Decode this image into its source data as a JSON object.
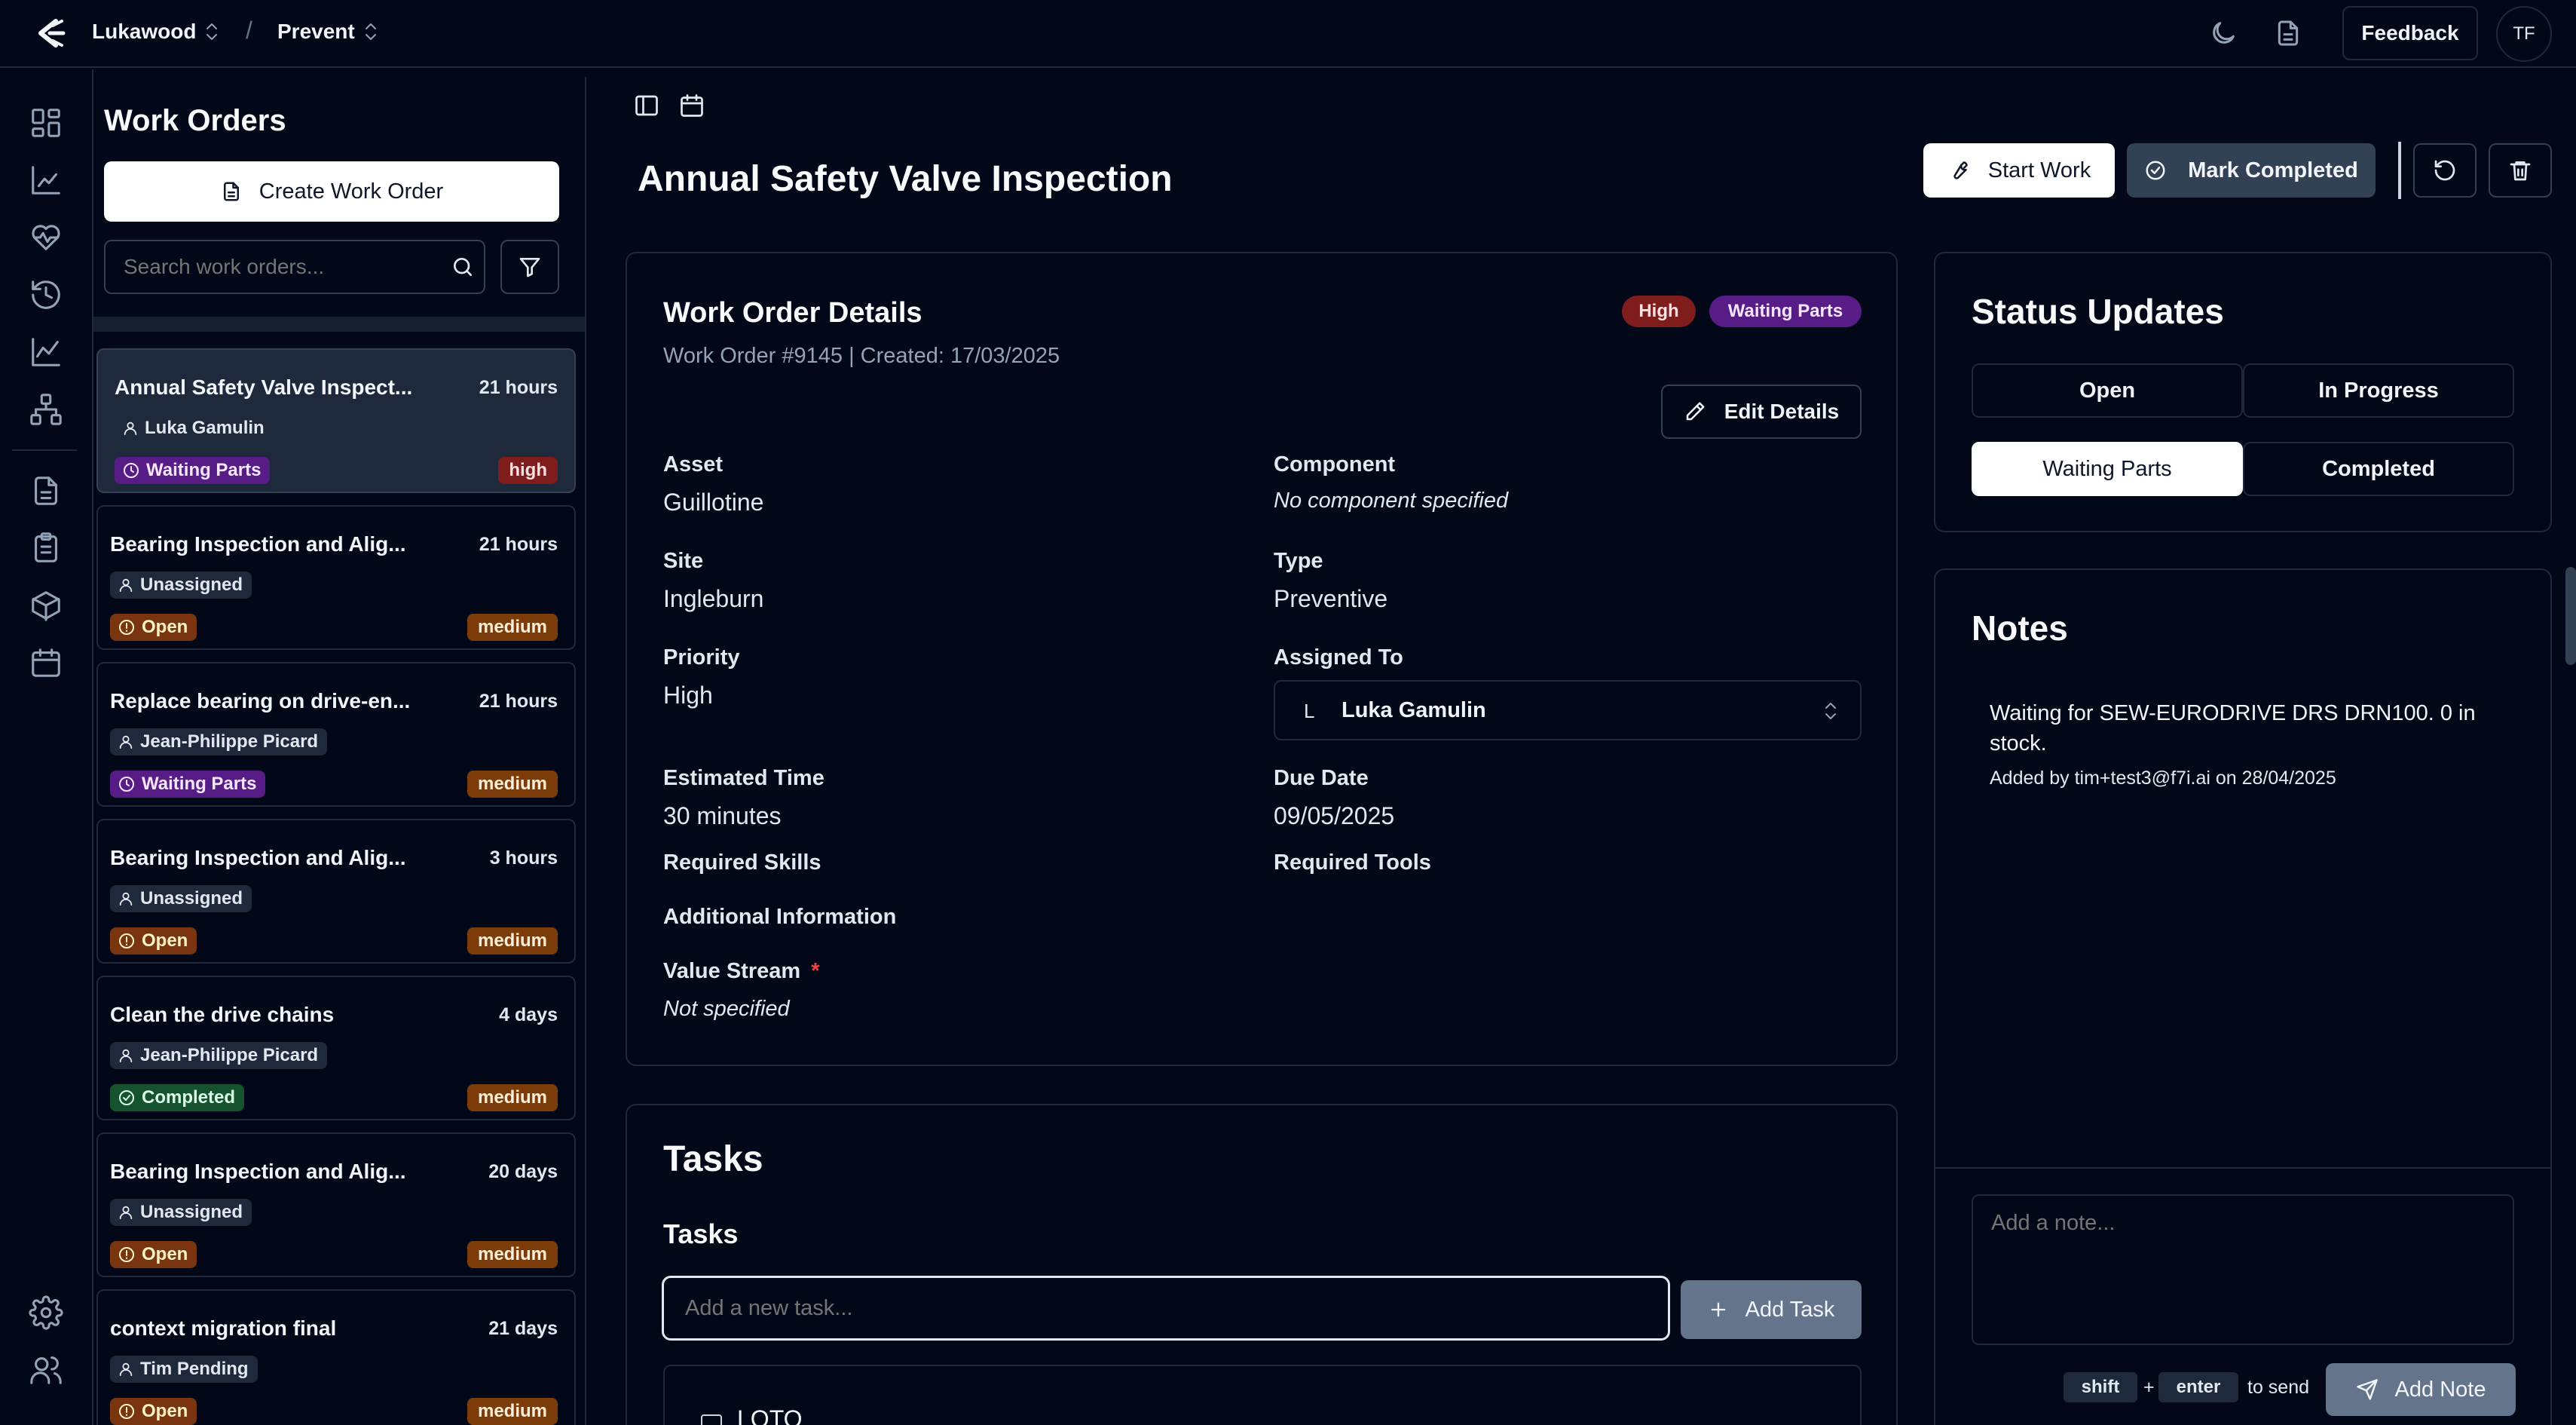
{
  "topbar": {
    "org": "Lukawood",
    "separator": "/",
    "app": "Prevent",
    "feedback": "Feedback",
    "avatar_initials": "TF"
  },
  "icons": {
    "logo": "chevron-burst-logo",
    "theme": "moon-icon",
    "docs": "document-icon",
    "rail": [
      "dashboard-icon",
      "bar-chart-icon",
      "heart-pulse-icon",
      "history-icon",
      "line-chart-icon",
      "hierarchy-icon",
      "work-orders-icon",
      "clipboard-icon",
      "box-icon",
      "calendar-icon",
      "settings-icon",
      "users-icon"
    ]
  },
  "list": {
    "title": "Work Orders",
    "create_label": "Create Work Order",
    "search_placeholder": "Search work orders...",
    "items": [
      {
        "title": "Annual Safety Valve Inspect...",
        "age": "21 hours",
        "assignee": "Luka Gamulin",
        "status": "Waiting Parts",
        "priority": "high"
      },
      {
        "title": "Bearing Inspection and Alig...",
        "age": "21 hours",
        "assignee": "Unassigned",
        "status": "Open",
        "priority": "medium"
      },
      {
        "title": "Replace bearing on drive-en...",
        "age": "21 hours",
        "assignee": "Jean-Philippe Picard",
        "status": "Waiting Parts",
        "priority": "medium"
      },
      {
        "title": "Bearing Inspection and Alig...",
        "age": "3 hours",
        "assignee": "Unassigned",
        "status": "Open",
        "priority": "medium"
      },
      {
        "title": "Clean the drive chains",
        "age": "4 days",
        "assignee": "Jean-Philippe Picard",
        "status": "Completed",
        "priority": "medium"
      },
      {
        "title": "Bearing Inspection and Alig...",
        "age": "20 days",
        "assignee": "Unassigned",
        "status": "Open",
        "priority": "medium"
      },
      {
        "title": "context migration final",
        "age": "21 days",
        "assignee": "Tim Pending",
        "status": "Open",
        "priority": "medium"
      }
    ]
  },
  "header": {
    "title": "Annual Safety Valve Inspection",
    "start_work": "Start Work",
    "mark_completed": "Mark Completed"
  },
  "details": {
    "heading": "Work Order Details",
    "subtitle": "Work Order #9145 | Created: 17/03/2025",
    "priority_tag": "High",
    "status_tag": "Waiting Parts",
    "edit_label": "Edit Details",
    "asset_label": "Asset",
    "asset_value": "Guillotine",
    "component_label": "Component",
    "component_value": "No component specified",
    "site_label": "Site",
    "site_value": "Ingleburn",
    "type_label": "Type",
    "type_value": "Preventive",
    "priority_label": "Priority",
    "priority_value": "High",
    "assigned_label": "Assigned To",
    "assigned_initial": "L",
    "assigned_value": "Luka Gamulin",
    "est_label": "Estimated Time",
    "est_value": "30 minutes",
    "due_label": "Due Date",
    "due_value": "09/05/2025",
    "skills_label": "Required Skills",
    "tools_label": "Required Tools",
    "additional_label": "Additional Information",
    "value_stream_label": "Value Stream",
    "required_marker": "*",
    "value_stream_value": "Not specified"
  },
  "tasks": {
    "heading": "Tasks",
    "subheading": "Tasks",
    "input_placeholder": "Add a new task...",
    "add_label": "Add Task",
    "first_task": "LOTO"
  },
  "status_updates": {
    "heading": "Status Updates",
    "options": [
      "Open",
      "In Progress",
      "Waiting Parts",
      "Completed"
    ],
    "active": "Waiting Parts"
  },
  "notes": {
    "heading": "Notes",
    "items": [
      {
        "text": "Waiting for SEW-EURODRIVE DRS DRN100. 0 in stock.",
        "meta": "Added by tim+test3@f7i.ai on 28/04/2025"
      }
    ],
    "input_placeholder": "Add a note...",
    "shortcut_key1": "shift",
    "shortcut_plus": "+",
    "shortcut_key2": "enter",
    "shortcut_suffix": "to send",
    "add_label": "Add Note"
  },
  "colors": {
    "background": "#020817",
    "border": "#1e293b",
    "high": "#7f1d1d",
    "waiting": "#581c87",
    "open": "#78350f",
    "completed": "#14532d",
    "medium": "#7c3c0a"
  }
}
